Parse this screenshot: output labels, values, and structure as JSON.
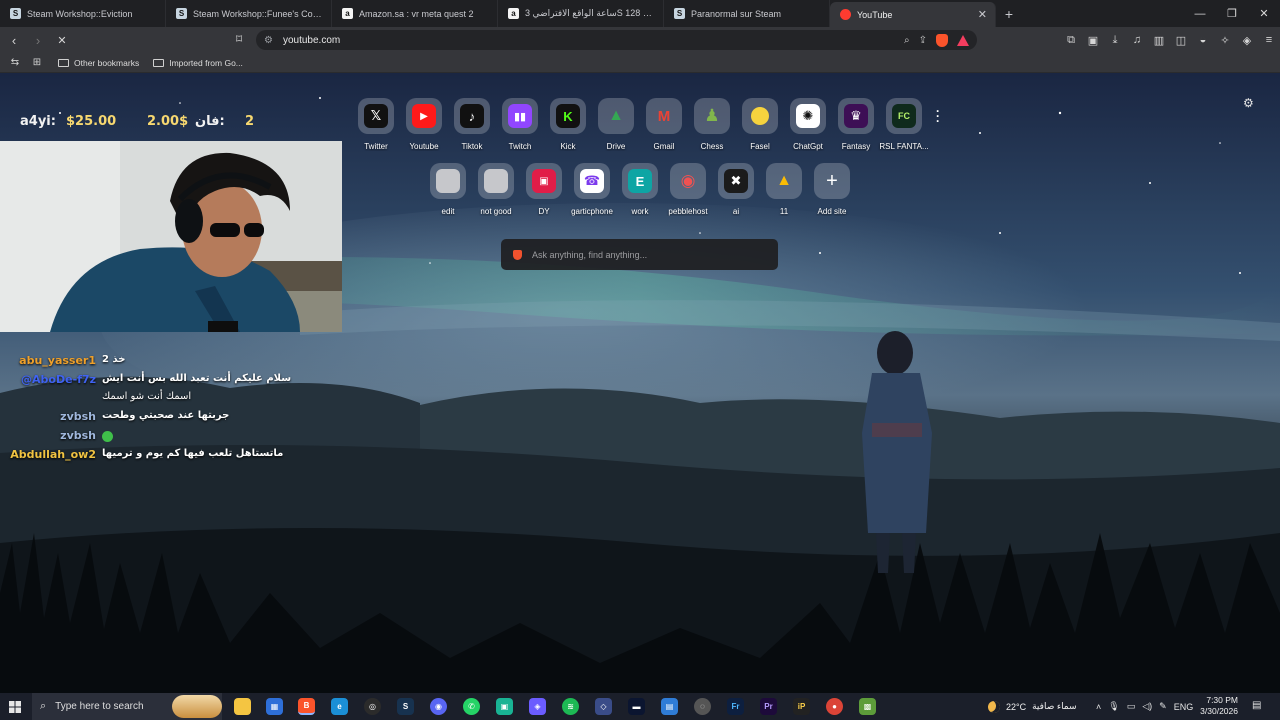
{
  "tabs": [
    {
      "title": "Steam Workshop::Eviction",
      "favicon_color": "#c7d5e0",
      "icon": "steam-icon"
    },
    {
      "title": "Steam Workshop::Funee's CoD: WaW",
      "favicon_color": "#c7d5e0",
      "icon": "steam-icon"
    },
    {
      "title": "Amazon.sa : vr meta quest 2",
      "favicon_color": "#f4f4f4",
      "icon": "amazon-icon"
    },
    {
      "title": "ساعة الواقع الافتراضي 3S بسعة 128 -",
      "favicon_color": "#f4f4f4",
      "icon": "amazon-icon"
    },
    {
      "title": "Paranormal sur Steam",
      "favicon_color": "#c7d5e0",
      "icon": "steam-icon"
    },
    {
      "title": "YouTube",
      "favicon_color": "#ff3b30",
      "icon": "youtube-icon",
      "active": true
    }
  ],
  "toolbar": {
    "url": "youtube.com"
  },
  "bookmarks": [
    {
      "label": "Other bookmarks"
    },
    {
      "label": "Imported from Go..."
    }
  ],
  "speed_dial": {
    "row1": [
      {
        "label": "Twitter",
        "icon": "x-icon",
        "color": "#111111",
        "glyph": "X"
      },
      {
        "label": "Youtube",
        "icon": "youtube-icon",
        "color": "#ff1a1a",
        "glyph": "▶"
      },
      {
        "label": "Tiktok",
        "icon": "tiktok-icon",
        "color": "#111111",
        "glyph": "♪"
      },
      {
        "label": "Twitch",
        "icon": "twitch-icon",
        "color": "#9146ff",
        "glyph": "▮"
      },
      {
        "label": "Kick",
        "icon": "kick-icon",
        "color": "#53fc18",
        "glyph": "K"
      },
      {
        "label": "Drive",
        "icon": "drive-icon",
        "color": "#2a6edb",
        "glyph": "▲"
      },
      {
        "label": "Gmail",
        "icon": "gmail-icon",
        "color": "#ea4335",
        "glyph": "M"
      },
      {
        "label": "Chess",
        "icon": "chess-icon",
        "color": "#81b64c",
        "glyph": "♟"
      },
      {
        "label": "Fasel",
        "icon": "fasel-icon",
        "color": "#f6d33e",
        "glyph": "●"
      },
      {
        "label": "ChatGpt",
        "icon": "chatgpt-icon",
        "color": "#ffffff",
        "glyph": "✺"
      },
      {
        "label": "Fantasy",
        "icon": "premier-league-icon",
        "color": "#3d0f55",
        "glyph": "♛"
      },
      {
        "label": "RSL FANTA...",
        "icon": "rsl-fantasy-icon",
        "color": "#0f2a1c",
        "glyph": "F"
      }
    ],
    "row2": [
      {
        "label": "edit",
        "icon": "edit-site-icon",
        "color": "#b9b9bd",
        "glyph": ""
      },
      {
        "label": "not good",
        "icon": "not-good-site-icon",
        "color": "#b9b9bd",
        "glyph": ""
      },
      {
        "label": "DY",
        "icon": "dy-icon",
        "color": "#e11d48",
        "glyph": "▣"
      },
      {
        "label": "garticphone",
        "icon": "garticphone-icon",
        "color": "#7c3aed",
        "glyph": "☎"
      },
      {
        "label": "work",
        "icon": "work-icon",
        "color": "#0ea5a4",
        "glyph": "E"
      },
      {
        "label": "pebblehost",
        "icon": "pebblehost-icon",
        "color": "#f05252",
        "glyph": "◉"
      },
      {
        "label": "ai",
        "icon": "ai-icon",
        "color": "#1b1b1b",
        "glyph": "✖"
      },
      {
        "label": "11",
        "icon": "drive-icon",
        "color": "#2a6edb",
        "glyph": "▲"
      },
      {
        "label": "Add site",
        "icon": "plus-icon",
        "color": "transparent",
        "glyph": "+"
      }
    ]
  },
  "search": {
    "placeholder": "Ask anything, find anything..."
  },
  "donation": {
    "name": "a4yi:",
    "amount": "$25.00",
    "amount_alt": "2.00$",
    "fan": "فان:",
    "count": "2"
  },
  "chat": [
    {
      "user": "abu_yasser1",
      "color": "#f0a12a",
      "msg": "خذ 2"
    },
    {
      "user": "@AboDe-f7z",
      "color": "#3f63f2",
      "msg": "سلام عليكم أنت تعبد الله بس أنت ايش"
    },
    {
      "user": "",
      "color": "#ffffff",
      "msg": "اسمك أنت شو اسمك"
    },
    {
      "user": "zvbsh",
      "color": "#9fb7dc",
      "msg": "جربتها عند صحبتي وطحت"
    },
    {
      "user": "zvbsh",
      "color": "#9fb7dc",
      "msg": ""
    },
    {
      "user": "Abdullah_ow2",
      "color": "#f0c342",
      "msg": "ماتستاهل تلعب فيها كم يوم و ترميها"
    }
  ],
  "taskbar": {
    "search_placeholder": "Type here to search",
    "weather_temp": "22°C",
    "weather_desc": "سماء صافية",
    "lang": "ENG",
    "time": "7:30 PM",
    "date": "3/30/2026"
  }
}
